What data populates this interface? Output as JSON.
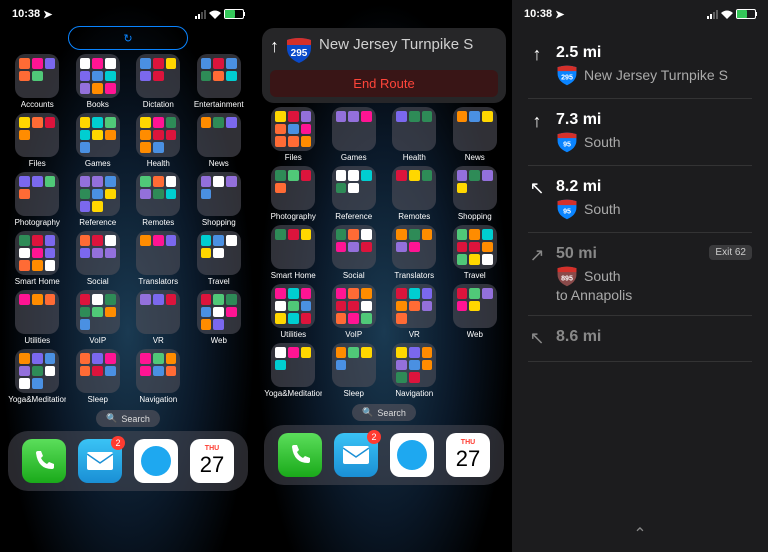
{
  "status": {
    "time": "10:38",
    "battery_color": "#34c759"
  },
  "pill_icon": "↻",
  "search_label": "Search",
  "folders_row1": [
    {
      "label": "Accounts"
    },
    {
      "label": "Books"
    },
    {
      "label": "Dictation"
    },
    {
      "label": "Entertainment"
    }
  ],
  "folders_row2": [
    {
      "label": "Files"
    },
    {
      "label": "Games"
    },
    {
      "label": "Health"
    },
    {
      "label": "News"
    }
  ],
  "folders_row3": [
    {
      "label": "Photography"
    },
    {
      "label": "Reference"
    },
    {
      "label": "Remotes"
    },
    {
      "label": "Shopping"
    }
  ],
  "folders_row4": [
    {
      "label": "Smart Home"
    },
    {
      "label": "Social"
    },
    {
      "label": "Translators"
    },
    {
      "label": "Travel"
    }
  ],
  "folders_row5": [
    {
      "label": "Utilities"
    },
    {
      "label": "VoIP"
    },
    {
      "label": "VR"
    },
    {
      "label": "Web"
    }
  ],
  "folders_row6": [
    {
      "label": "Yoga&Meditation"
    },
    {
      "label": "Sleep"
    },
    {
      "label": "Navigation"
    }
  ],
  "dock": {
    "mail_badge": "2",
    "cal_day": "THU",
    "cal_date": "27"
  },
  "nav_banner": {
    "route_num": "295",
    "route_name": "New Jersey Turnpike S",
    "end_label": "End Route"
  },
  "directions": [
    {
      "dist": "2.5 mi",
      "shield": "295",
      "shield_color": "#0a84ff",
      "label": "New Jersey Turnpike S",
      "arrow": "↑"
    },
    {
      "dist": "7.3 mi",
      "shield": "95",
      "shield_color": "#0a84ff",
      "label": "South",
      "arrow": "↑"
    },
    {
      "dist": "8.2 mi",
      "shield": "95",
      "shield_color": "#0a84ff",
      "label": "South",
      "arrow": "↖"
    },
    {
      "dist": "50 mi",
      "shield": "895",
      "shield_color": "#8a4a4a",
      "label": "South",
      "extra": "to Annapolis",
      "exit": "Exit 62",
      "arrow": "↗",
      "faded": true
    },
    {
      "dist": "8.6 mi",
      "shield": "",
      "label": "",
      "arrow": "↖",
      "faded": true
    }
  ]
}
